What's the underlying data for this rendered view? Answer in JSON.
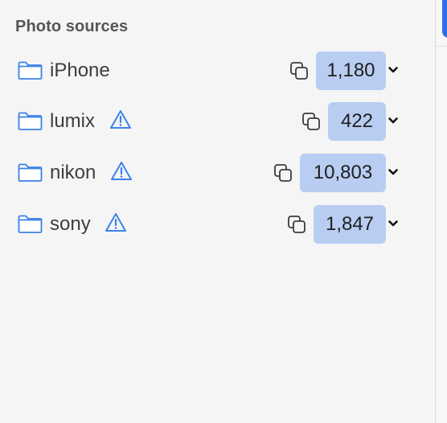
{
  "sidebar": {
    "title": "Photo sources",
    "items": [
      {
        "name": "iPhone",
        "count": "1,180",
        "warning": false,
        "icon": "folder-icon"
      },
      {
        "name": "lumix",
        "count": "422",
        "warning": true,
        "icon": "folder-icon"
      },
      {
        "name": "nikon",
        "count": "10,803",
        "warning": true,
        "icon": "folder-icon"
      },
      {
        "name": "sony",
        "count": "1,847",
        "warning": true,
        "icon": "folder-icon"
      }
    ]
  },
  "colors": {
    "accent": "#2f6fe4",
    "badge": "#b8cdf1",
    "icon_blue": "#3b82e8"
  }
}
